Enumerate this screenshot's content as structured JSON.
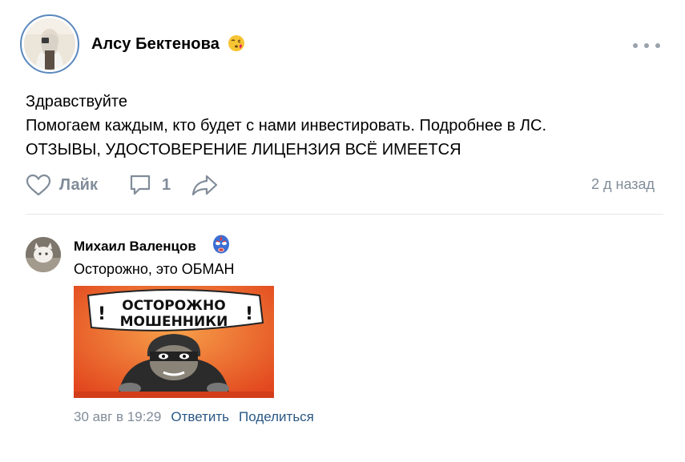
{
  "post": {
    "author_name": "Алсу Бектенова",
    "author_emoji": "kiss-emoji",
    "lines": [
      "Здравствуйте",
      "Помогаем каждым, кто будет с нами инвестировать. Подробнее в ЛС.",
      "ОТЗЫВЫ, УДОСТОВЕРЕНИЕ ЛИЦЕНЗИЯ ВСЁ ИМЕЕТСЯ"
    ],
    "like_label": "Лайк",
    "comment_count": "1",
    "time": "2 д назад"
  },
  "comment": {
    "author_name": "Михаил Валенцов",
    "author_badge": "luchador-mask-emoji",
    "text": "Осторожно, это ОБМАН",
    "image_text_line1": "ОСТОРОЖНО",
    "image_text_line2": "МОШЕННИКИ",
    "image_exclaim": "!",
    "date": "30 авг в 19:29",
    "reply_label": "Ответить",
    "share_label": "Поделиться"
  },
  "colors": {
    "muted": "#818c99",
    "link": "#2a5885",
    "divider": "#e7e8ec",
    "avatar_ring": "#5b88bd",
    "image_bg": "#e86a2d"
  }
}
